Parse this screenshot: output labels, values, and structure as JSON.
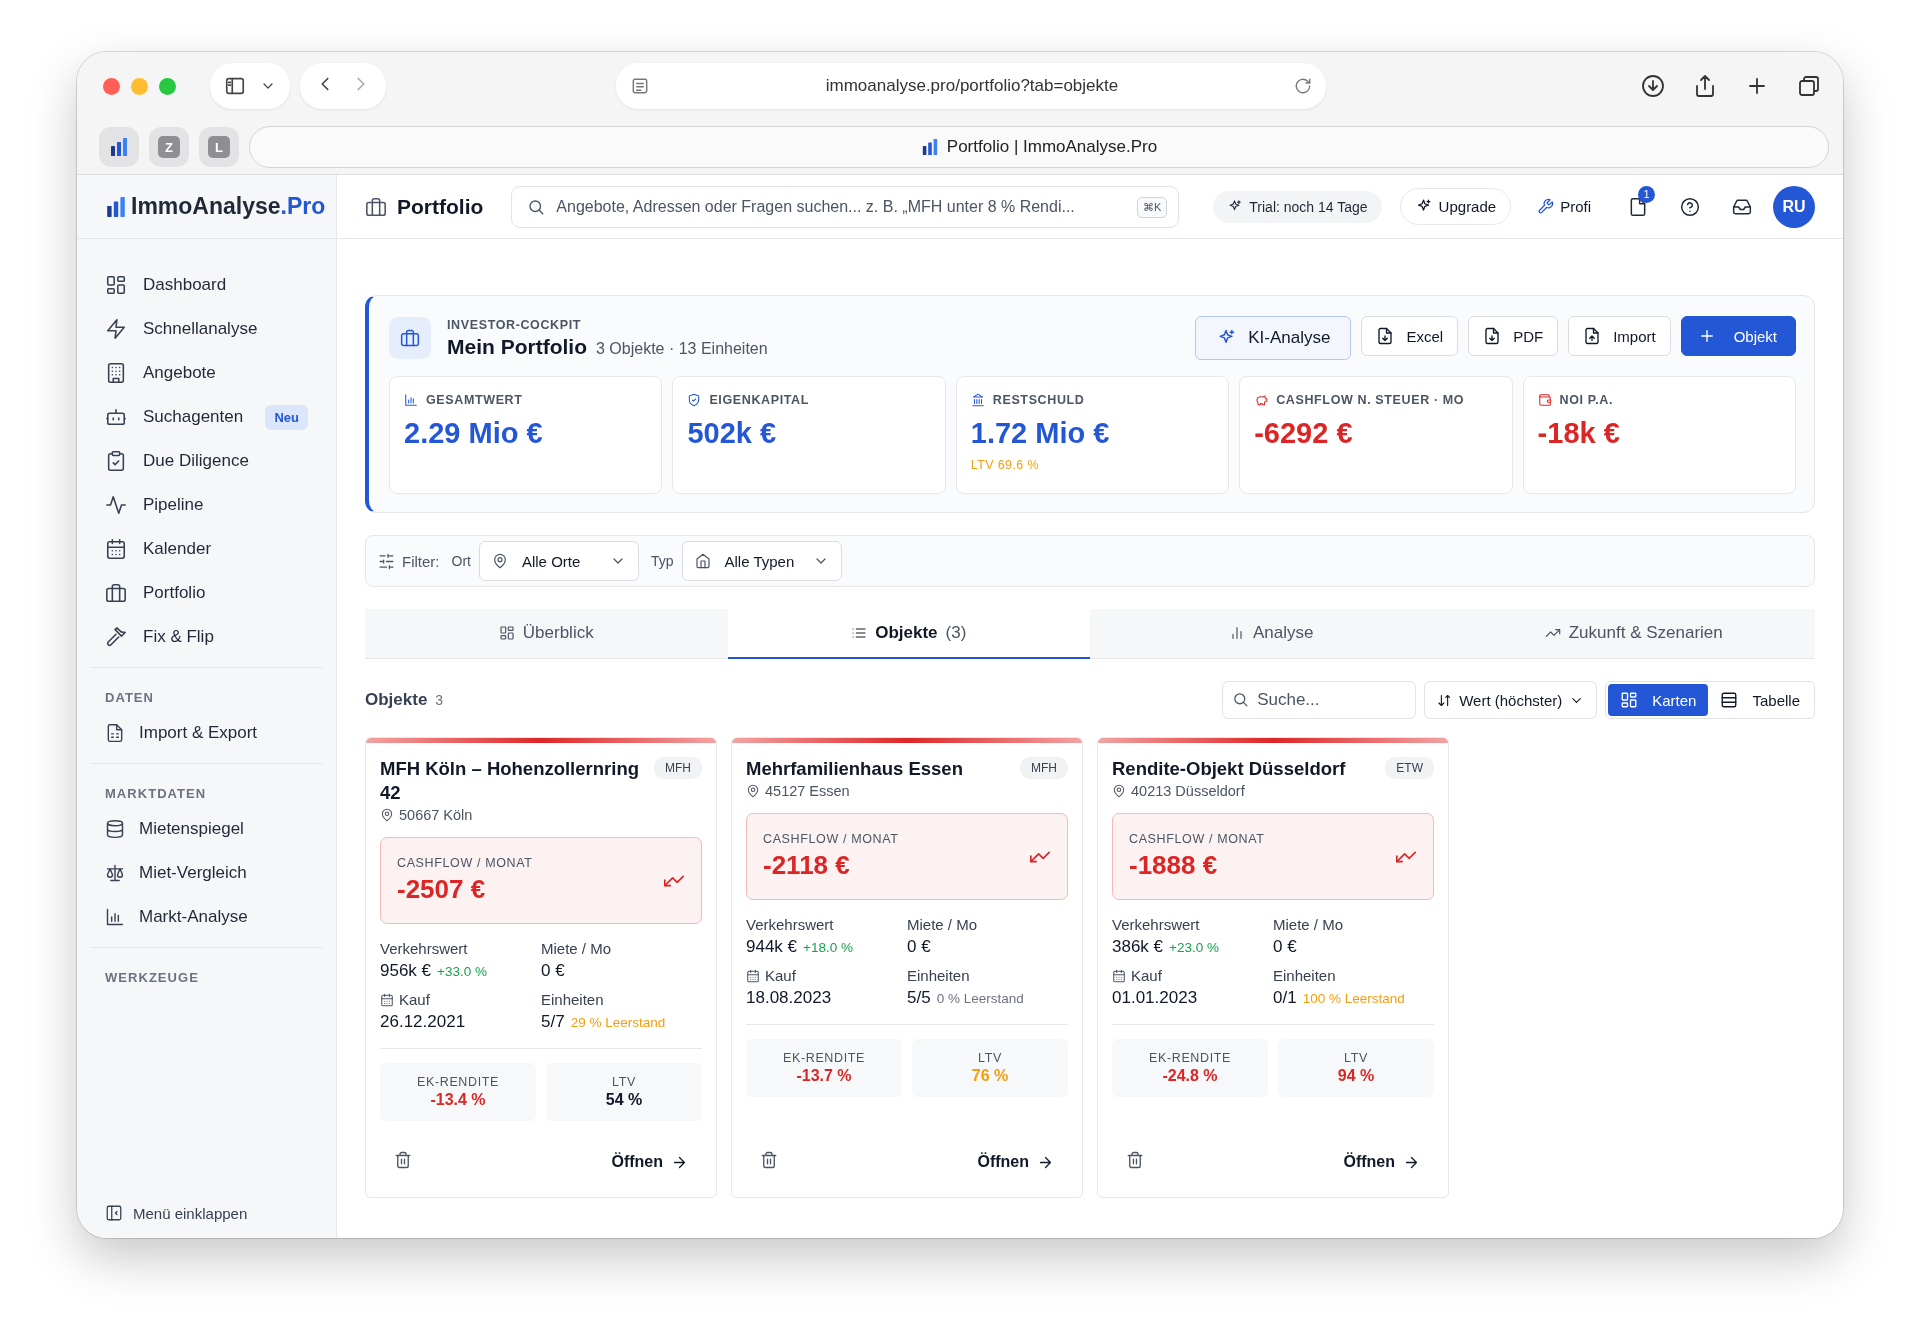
{
  "browser": {
    "url": "immoanalyse.pro/portfolio?tab=objekte",
    "tab_title": "Portfolio | ImmoAnalyse.Pro",
    "pinned_tabs": [
      "Z",
      "L"
    ]
  },
  "sidebar": {
    "logo": "ImmoAnalyse",
    "logo_suffix": ".Pro",
    "items": [
      {
        "label": "Dashboard"
      },
      {
        "label": "Schnellanalyse"
      },
      {
        "label": "Angebote"
      },
      {
        "label": "Suchagenten",
        "badge": "Neu"
      },
      {
        "label": "Due Diligence"
      },
      {
        "label": "Pipeline"
      },
      {
        "label": "Kalender"
      },
      {
        "label": "Portfolio"
      },
      {
        "label": "Fix & Flip"
      }
    ],
    "sections": [
      {
        "title": "DATEN",
        "items": [
          {
            "label": "Import & Export"
          }
        ]
      },
      {
        "title": "MARKTDATEN",
        "items": [
          {
            "label": "Mietenspiegel"
          },
          {
            "label": "Miet-Vergleich"
          },
          {
            "label": "Markt-Analyse"
          }
        ]
      },
      {
        "title": "WERKZEUGE"
      }
    ],
    "collapse": "Menü einklappen"
  },
  "header": {
    "title": "Portfolio",
    "search_placeholder": "Angebote, Adressen oder Fragen suchen... z. B. „MFH unter 8 % Rendi...",
    "shortcut": "⌘K",
    "trial": "Trial: noch 14 Tage",
    "upgrade": "Upgrade",
    "plan": "Profi",
    "notification_count": "1",
    "avatar": "RU"
  },
  "cockpit": {
    "eyebrow": "INVESTOR-COCKPIT",
    "title": "Mein Portfolio",
    "subtitle": "3 Objekte · 13 Einheiten",
    "actions": [
      {
        "label": "KI-Analyse",
        "kind": "ai"
      },
      {
        "label": "Excel",
        "kind": "download"
      },
      {
        "label": "PDF",
        "kind": "download"
      },
      {
        "label": "Import",
        "kind": "upload"
      },
      {
        "label": "Objekt",
        "kind": "primary"
      }
    ],
    "kpis": [
      {
        "label": "GESAMTWERT",
        "value": "2.29 Mio €",
        "color": "#2457d6"
      },
      {
        "label": "EIGENKAPITAL",
        "value": "502k €",
        "color": "#2457d6"
      },
      {
        "label": "RESTSCHULD",
        "value": "1.72 Mio €",
        "color": "#2457d6",
        "note": "LTV 69.6 %"
      },
      {
        "label": "CASHFLOW N. STEUER · MO",
        "value": "-6292 €",
        "color": "#dc2626"
      },
      {
        "label": "NOI P.A.",
        "value": "-18k €",
        "color": "#dc2626"
      }
    ]
  },
  "filter": {
    "label": "Filter:",
    "fields": [
      {
        "label": "Ort",
        "value": "Alle Orte"
      },
      {
        "label": "Typ",
        "value": "Alle Typen"
      }
    ]
  },
  "tabs": [
    {
      "label": "Überblick",
      "selected": false
    },
    {
      "label": "Objekte",
      "count": "(3)",
      "selected": true
    },
    {
      "label": "Analyse",
      "selected": false
    },
    {
      "label": "Zukunft & Szenarien",
      "selected": false
    }
  ],
  "list": {
    "title": "Objekte",
    "count": "3",
    "search_placeholder": "Suche...",
    "sort": "Wert (höchster)",
    "views": [
      {
        "label": "Karten",
        "selected": true
      },
      {
        "label": "Tabelle",
        "selected": false
      }
    ]
  },
  "objects": [
    {
      "title": "MFH Köln – Hohenzollernring 42",
      "type": "MFH",
      "location": "50667 Köln",
      "cashflow_label": "CASHFLOW / MONAT",
      "cashflow": "-2507 €",
      "value_label": "Verkehrswert",
      "value": "956k €",
      "value_change": "+33.0 %",
      "rent_label": "Miete / Mo",
      "rent": "0 €",
      "purchase_label": "Kauf",
      "purchase_date": "26.12.2021",
      "units_label": "Einheiten",
      "units": "5/7",
      "vacancy": {
        "text": "29 % Leerstand",
        "color": "#f59e0b"
      },
      "metrics": [
        {
          "label": "EK-RENDITE",
          "value": "-13.4 %",
          "color": "#dc2626"
        },
        {
          "label": "LTV",
          "value": "54 %",
          "color": "#111827"
        }
      ],
      "open": "Öffnen"
    },
    {
      "title": "Mehrfamilienhaus Essen",
      "type": "MFH",
      "location": "45127 Essen",
      "cashflow_label": "CASHFLOW / MONAT",
      "cashflow": "-2118 €",
      "value_label": "Verkehrswert",
      "value": "944k €",
      "value_change": "+18.0 %",
      "rent_label": "Miete / Mo",
      "rent": "0 €",
      "purchase_label": "Kauf",
      "purchase_date": "18.08.2023",
      "units_label": "Einheiten",
      "units": "5/5",
      "vacancy": {
        "text": "0 % Leerstand",
        "color": "#6b7280"
      },
      "metrics": [
        {
          "label": "EK-RENDITE",
          "value": "-13.7 %",
          "color": "#dc2626"
        },
        {
          "label": "LTV",
          "value": "76 %",
          "color": "#f59e0b"
        }
      ],
      "open": "Öffnen"
    },
    {
      "title": "Rendite-Objekt Düsseldorf",
      "type": "ETW",
      "location": "40213 Düsseldorf",
      "cashflow_label": "CASHFLOW / MONAT",
      "cashflow": "-1888 €",
      "value_label": "Verkehrswert",
      "value": "386k €",
      "value_change": "+23.0 %",
      "rent_label": "Miete / Mo",
      "rent": "0 €",
      "purchase_label": "Kauf",
      "purchase_date": "01.01.2023",
      "units_label": "Einheiten",
      "units": "0/1",
      "vacancy": {
        "text": "100 % Leerstand",
        "color": "#f59e0b"
      },
      "metrics": [
        {
          "label": "EK-RENDITE",
          "value": "-24.8 %",
          "color": "#dc2626"
        },
        {
          "label": "LTV",
          "value": "94 %",
          "color": "#dc2626"
        }
      ],
      "open": "Öffnen"
    }
  ]
}
